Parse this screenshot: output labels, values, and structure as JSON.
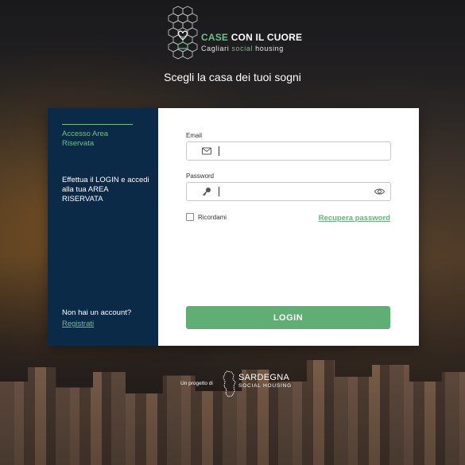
{
  "brand": {
    "title_main": "CASE",
    "title_accent": "CON IL CUORE",
    "subtitle_pre": "Cagliari",
    "subtitle_accent": "social",
    "subtitle_post": "housing",
    "logo_icon": "honeycomb-heart-icon"
  },
  "tagline": "Scegli la casa dei tuoi sogni",
  "left_panel": {
    "area_label": "Accesso Area Riservata",
    "login_info": "Effettua il LOGIN e accedi alla tua AREA RISERVATA",
    "no_account": "Non hai un account?",
    "register_link": "Registrati"
  },
  "form": {
    "email_label": "Email",
    "email_value": "",
    "email_icon": "envelope-icon",
    "password_label": "Password",
    "password_value": "",
    "password_icon": "key-icon",
    "show_password_icon": "eye-icon",
    "remember_label": "Ricordami",
    "remember_checked": false,
    "recover_link": "Recupera password",
    "login_button": "LOGIN"
  },
  "footer": {
    "project_of": "Un progetto di",
    "partner_title": "SARDEGNA",
    "partner_subtitle": "SOCIAL HOUSING",
    "partner_icon": "sardinia-island-icon"
  },
  "colors": {
    "accent_green": "#5fae73",
    "panel_navy": "#0b2a47",
    "link_green": "#6fc08a"
  }
}
